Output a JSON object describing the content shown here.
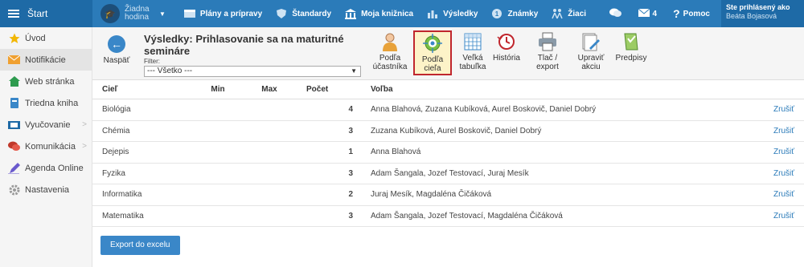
{
  "topbar": {
    "start_label": "Štart",
    "hodina_label": "Žiadna hodina",
    "nav": [
      {
        "label": "Plány a prípravy",
        "icon": "calendar-icon"
      },
      {
        "label": "Štandardy",
        "icon": "shield-icon"
      },
      {
        "label": "Moja knižnica",
        "icon": "library-icon"
      },
      {
        "label": "Výsledky",
        "icon": "bar-chart-icon"
      },
      {
        "label": "Známky",
        "icon": "grades-icon"
      },
      {
        "label": "Žiaci",
        "icon": "students-icon"
      }
    ],
    "messages_count": "4",
    "help_label": "Pomoc",
    "user_line1": "Ste prihlásený ako",
    "user_line2": "Beáta Bojasová"
  },
  "sidebar": {
    "items": [
      {
        "label": "Úvod",
        "icon": "star-icon"
      },
      {
        "label": "Notifikácie",
        "icon": "envelope-icon"
      },
      {
        "label": "Web stránka",
        "icon": "home-icon"
      },
      {
        "label": "Triedna kniha",
        "icon": "book-icon"
      },
      {
        "label": "Vyučovanie",
        "icon": "teaching-icon"
      },
      {
        "label": "Komunikácia",
        "icon": "chat-icon"
      },
      {
        "label": "Agenda Online",
        "icon": "pen-icon"
      },
      {
        "label": "Nastavenia",
        "icon": "gear-icon"
      }
    ]
  },
  "toolbar": {
    "back_label": "Naspäť",
    "title": "Výsledky: Prihlasovanie sa na maturitné semináre",
    "filter_label": "Filter:",
    "filter_value": "--- Všetko ---",
    "buttons": [
      {
        "label": "Podľa účastníka"
      },
      {
        "label": "Podľa cieľa"
      },
      {
        "label": "Veľká tabuľka"
      },
      {
        "label": "História"
      },
      {
        "label": "Tlač / export"
      },
      {
        "label": "Upraviť akciu"
      },
      {
        "label": "Predpisy"
      }
    ]
  },
  "table": {
    "headers": {
      "ciel": "Cieľ",
      "min": "Min",
      "max": "Max",
      "pocet": "Počet",
      "volba": "Voľba"
    },
    "rows": [
      {
        "ciel": "Biológia",
        "pocet": "4",
        "volba": "Anna Blahová, Zuzana Kubíková, Aurel Boskovič, Daniel Dobrý",
        "action": "Zrušiť"
      },
      {
        "ciel": "Chémia",
        "pocet": "3",
        "volba": "Zuzana Kubíková, Aurel Boskovič, Daniel Dobrý",
        "action": "Zrušiť"
      },
      {
        "ciel": "Dejepis",
        "pocet": "1",
        "volba": "Anna Blahová",
        "action": "Zrušiť"
      },
      {
        "ciel": "Fyzika",
        "pocet": "3",
        "volba": "Adam Šangala, Jozef Testovací, Juraj Mesík",
        "action": "Zrušiť"
      },
      {
        "ciel": "Informatika",
        "pocet": "2",
        "volba": "Juraj Mesík, Magdaléna Čičáková",
        "action": "Zrušiť"
      },
      {
        "ciel": "Matematika",
        "pocet": "3",
        "volba": "Adam Šangala, Jozef Testovací, Magdaléna Čičáková",
        "action": "Zrušiť"
      }
    ]
  },
  "export_label": "Export do excelu",
  "colors": {
    "topbar": "#2b7bb9",
    "accent": "#3a87c8",
    "selected_border": "#c0262d"
  }
}
